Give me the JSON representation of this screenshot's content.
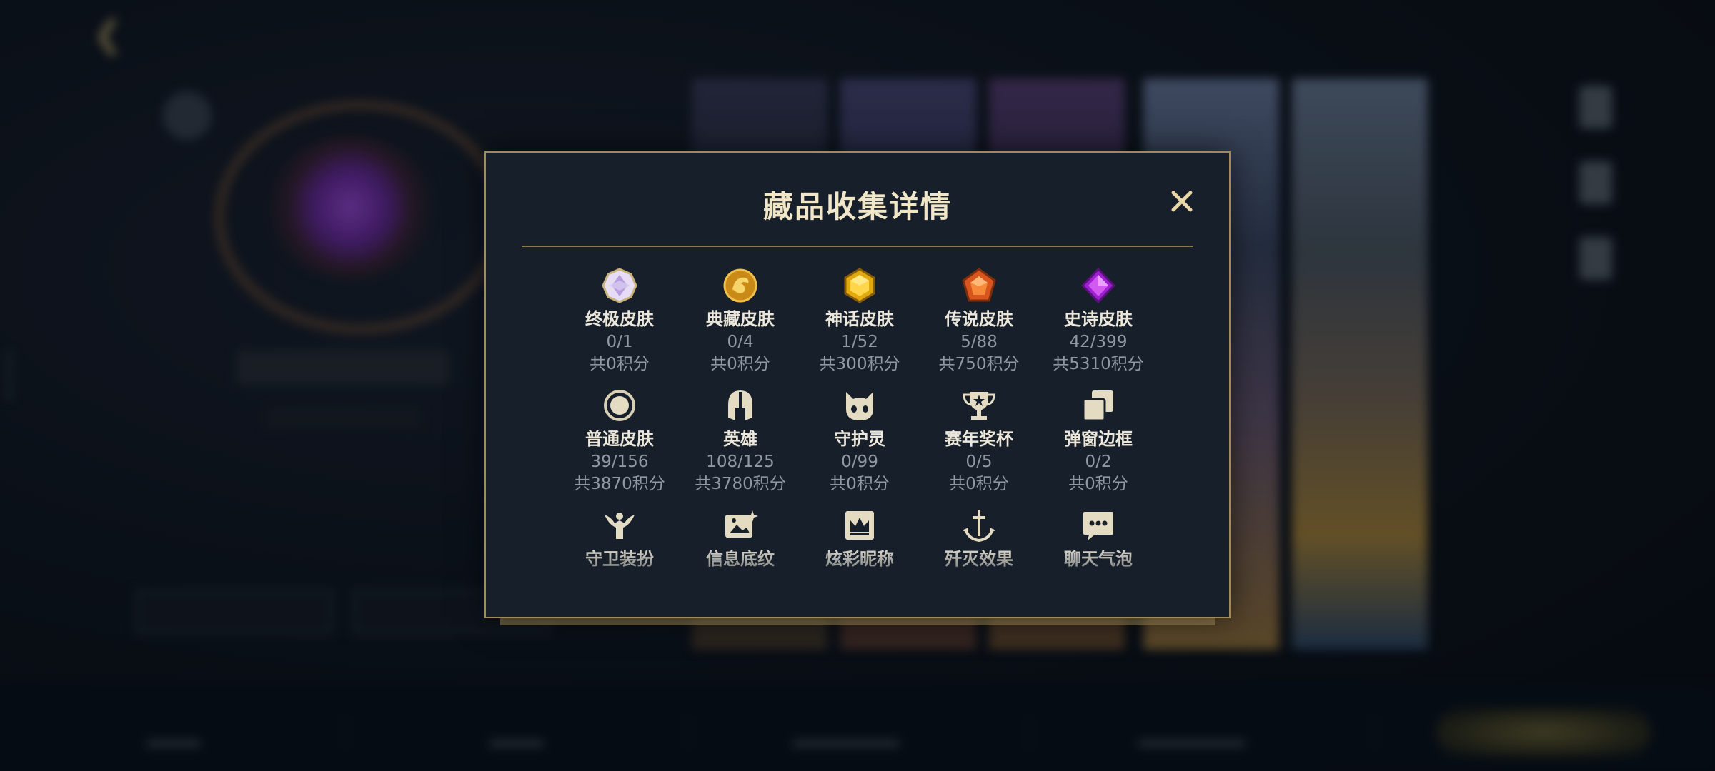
{
  "background": {
    "back_label": "",
    "side_id": "39939765"
  },
  "modal": {
    "title": "藏品收集详情",
    "close_glyph": "✕",
    "accent_color": "#d9c08a",
    "items": [
      {
        "name": "终极皮肤",
        "count": "0/1",
        "points": "共0积分",
        "icon": "ultimate-gem-icon"
      },
      {
        "name": "典藏皮肤",
        "count": "0/4",
        "points": "共0积分",
        "icon": "dragon-medal-icon"
      },
      {
        "name": "神话皮肤",
        "count": "1/52",
        "points": "共300积分",
        "icon": "mythic-gem-icon"
      },
      {
        "name": "传说皮肤",
        "count": "5/88",
        "points": "共750积分",
        "icon": "legendary-gem-icon"
      },
      {
        "name": "史诗皮肤",
        "count": "42/399",
        "points": "共5310积分",
        "icon": "epic-gem-icon"
      },
      {
        "name": "普通皮肤",
        "count": "39/156",
        "points": "共3870积分",
        "icon": "common-ring-icon"
      },
      {
        "name": "英雄",
        "count": "108/125",
        "points": "共3780积分",
        "icon": "helmet-icon"
      },
      {
        "name": "守护灵",
        "count": "0/99",
        "points": "共0积分",
        "icon": "guardian-face-icon"
      },
      {
        "name": "赛年奖杯",
        "count": "0/5",
        "points": "共0积分",
        "icon": "trophy-icon"
      },
      {
        "name": "弹窗边框",
        "count": "0/2",
        "points": "共0积分",
        "icon": "frame-stack-icon"
      },
      {
        "name": "守卫装扮",
        "count": "",
        "points": "",
        "icon": "ward-icon"
      },
      {
        "name": "信息底纹",
        "count": "",
        "points": "",
        "icon": "card-sparkle-icon"
      },
      {
        "name": "炫彩昵称",
        "count": "",
        "points": "",
        "icon": "crown-banner-icon"
      },
      {
        "name": "歼灭效果",
        "count": "",
        "points": "",
        "icon": "anchor-sword-icon"
      },
      {
        "name": "聊天气泡",
        "count": "",
        "points": "",
        "icon": "chat-bubble-icon"
      }
    ]
  }
}
